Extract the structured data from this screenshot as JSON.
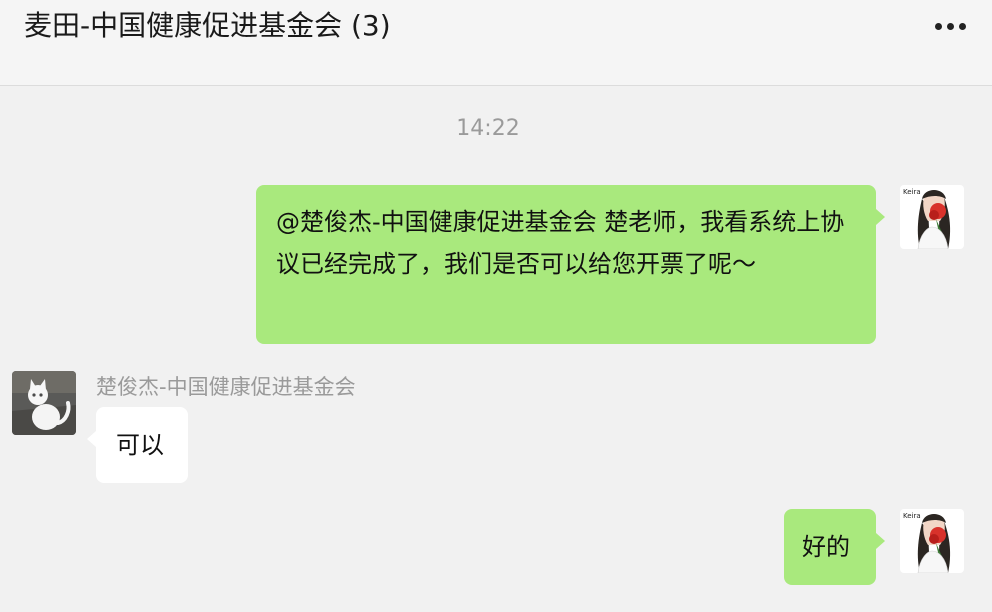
{
  "header": {
    "title": "麦田-中国健康促进基金会  (3)",
    "more_icon": "more-icon"
  },
  "chat": {
    "timestamp": "14:22",
    "messages": [
      {
        "direction": "outgoing",
        "text": "@楚俊杰-中国健康促进基金会 楚老师，我看系统上协议已经完成了，我们是否可以给您开票了呢～",
        "avatar_label": "Keira"
      },
      {
        "direction": "incoming",
        "sender": "楚俊杰-中国健康促进基金会",
        "text": "可以"
      },
      {
        "direction": "outgoing",
        "text": "好的",
        "avatar_label": "Keira"
      }
    ]
  },
  "colors": {
    "outgoing_bubble": "#a9e97d",
    "incoming_bubble": "#ffffff",
    "background": "#f1f1f1"
  }
}
